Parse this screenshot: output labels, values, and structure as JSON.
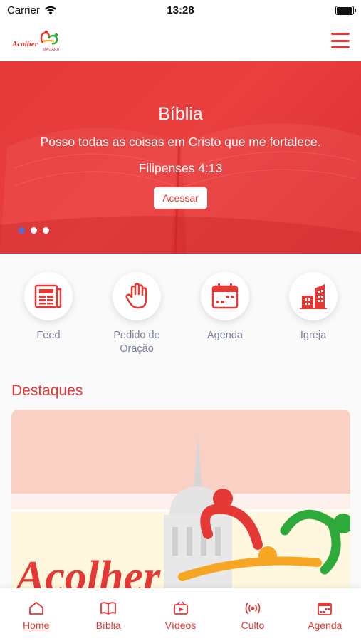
{
  "status_bar": {
    "carrier": "Carrier",
    "time": "13:28",
    "battery_level": 0.95
  },
  "header": {
    "logo_text": "Acolher",
    "logo_subtext": "MACAPÁ",
    "menu_icon": "hamburger-menu-icon"
  },
  "hero": {
    "title": "Bíblia",
    "verse": "Posso todas as coisas em Cristo que me fortalece.",
    "reference": "Filipenses 4:13",
    "button_label": "Acessar",
    "slide_count": 3,
    "active_slide": 1
  },
  "shortcuts": [
    {
      "label": "Feed",
      "icon": "newspaper-icon"
    },
    {
      "label": "Pedido de Oração",
      "icon": "hand-icon"
    },
    {
      "label": "Agenda",
      "icon": "calendar-icon"
    },
    {
      "label": "Igreja",
      "icon": "building-icon"
    }
  ],
  "highlights": {
    "section_title": "Destaques",
    "banner_text": "Acolher"
  },
  "bottom_nav": [
    {
      "label": "Home",
      "icon": "home-icon",
      "active": true
    },
    {
      "label": "Bíblia",
      "icon": "book-icon",
      "active": false
    },
    {
      "label": "Vídeos",
      "icon": "video-icon",
      "active": false
    },
    {
      "label": "Culto",
      "icon": "broadcast-icon",
      "active": false
    },
    {
      "label": "Agenda",
      "icon": "calendar-icon",
      "active": false
    }
  ],
  "colors": {
    "brand_red": "#e53935",
    "muted_label": "#7a7f99",
    "active_dot": "#4f6fd1"
  }
}
